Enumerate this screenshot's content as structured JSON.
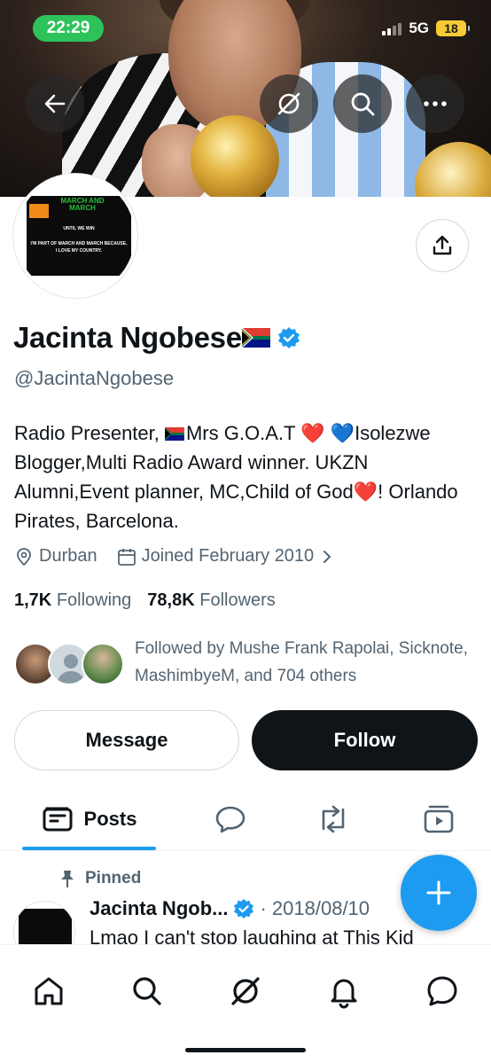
{
  "status_bar": {
    "time": "22:29",
    "network": "5G",
    "battery": "18"
  },
  "header": {
    "back_icon": "arrow-left-icon",
    "grok_icon": "grok-icon",
    "search_icon": "search-icon",
    "more_icon": "more-horizontal-icon"
  },
  "avatar_image": {
    "title": "MARCH AND MARCH",
    "subtitle": "UNTIL WE WIN",
    "text": "I'M PART OF MARCH AND MARCH BECAUSE, I LOVE MY COUNTRY.",
    "tag": "NO"
  },
  "profile": {
    "name": "Jacinta Ngobese",
    "handle": "@JacintaNgobese",
    "verified": true,
    "bio_part1": "Radio Presenter, ",
    "bio_part2": "Mrs G.O.A.T ",
    "bio_heart_red": "❤️",
    "bio_heart_blue": "💙",
    "bio_part3": "Isolezwe Blogger,Multi Radio Award winner. UKZN Alumni,Event planner, MC,Child of God",
    "bio_heart_end": "❤️",
    "bio_part4": "! Orlando Pirates, Barcelona.",
    "location": "Durban",
    "joined": "Joined February 2010",
    "following_count": "1,7K",
    "following_label": "Following",
    "followers_count": "78,8K",
    "followers_label": "Followers",
    "followed_by": "Followed by Mushe Frank Rapolai, Sicknote, MashimbyeM, and 704 others"
  },
  "actions": {
    "message": "Message",
    "follow": "Follow"
  },
  "tabs": [
    {
      "label": "Posts",
      "icon": "posts-icon",
      "active": true
    },
    {
      "label": "",
      "icon": "replies-icon"
    },
    {
      "label": "",
      "icon": "reposts-icon"
    },
    {
      "label": "",
      "icon": "media-icon"
    }
  ],
  "pinned_post": {
    "pinned_label": "Pinned",
    "author": "Jacinta Ngob...",
    "date": "· 2018/08/10",
    "text": "Lmao I can't stop laughing at This Kid"
  },
  "bottom_nav": [
    "home-icon",
    "search-icon",
    "grok-icon",
    "notifications-icon",
    "messages-icon"
  ],
  "colors": {
    "accent": "#1d9bf0",
    "text": "#0f1419",
    "secondary": "#536471",
    "status_green": "#2ec35a"
  }
}
